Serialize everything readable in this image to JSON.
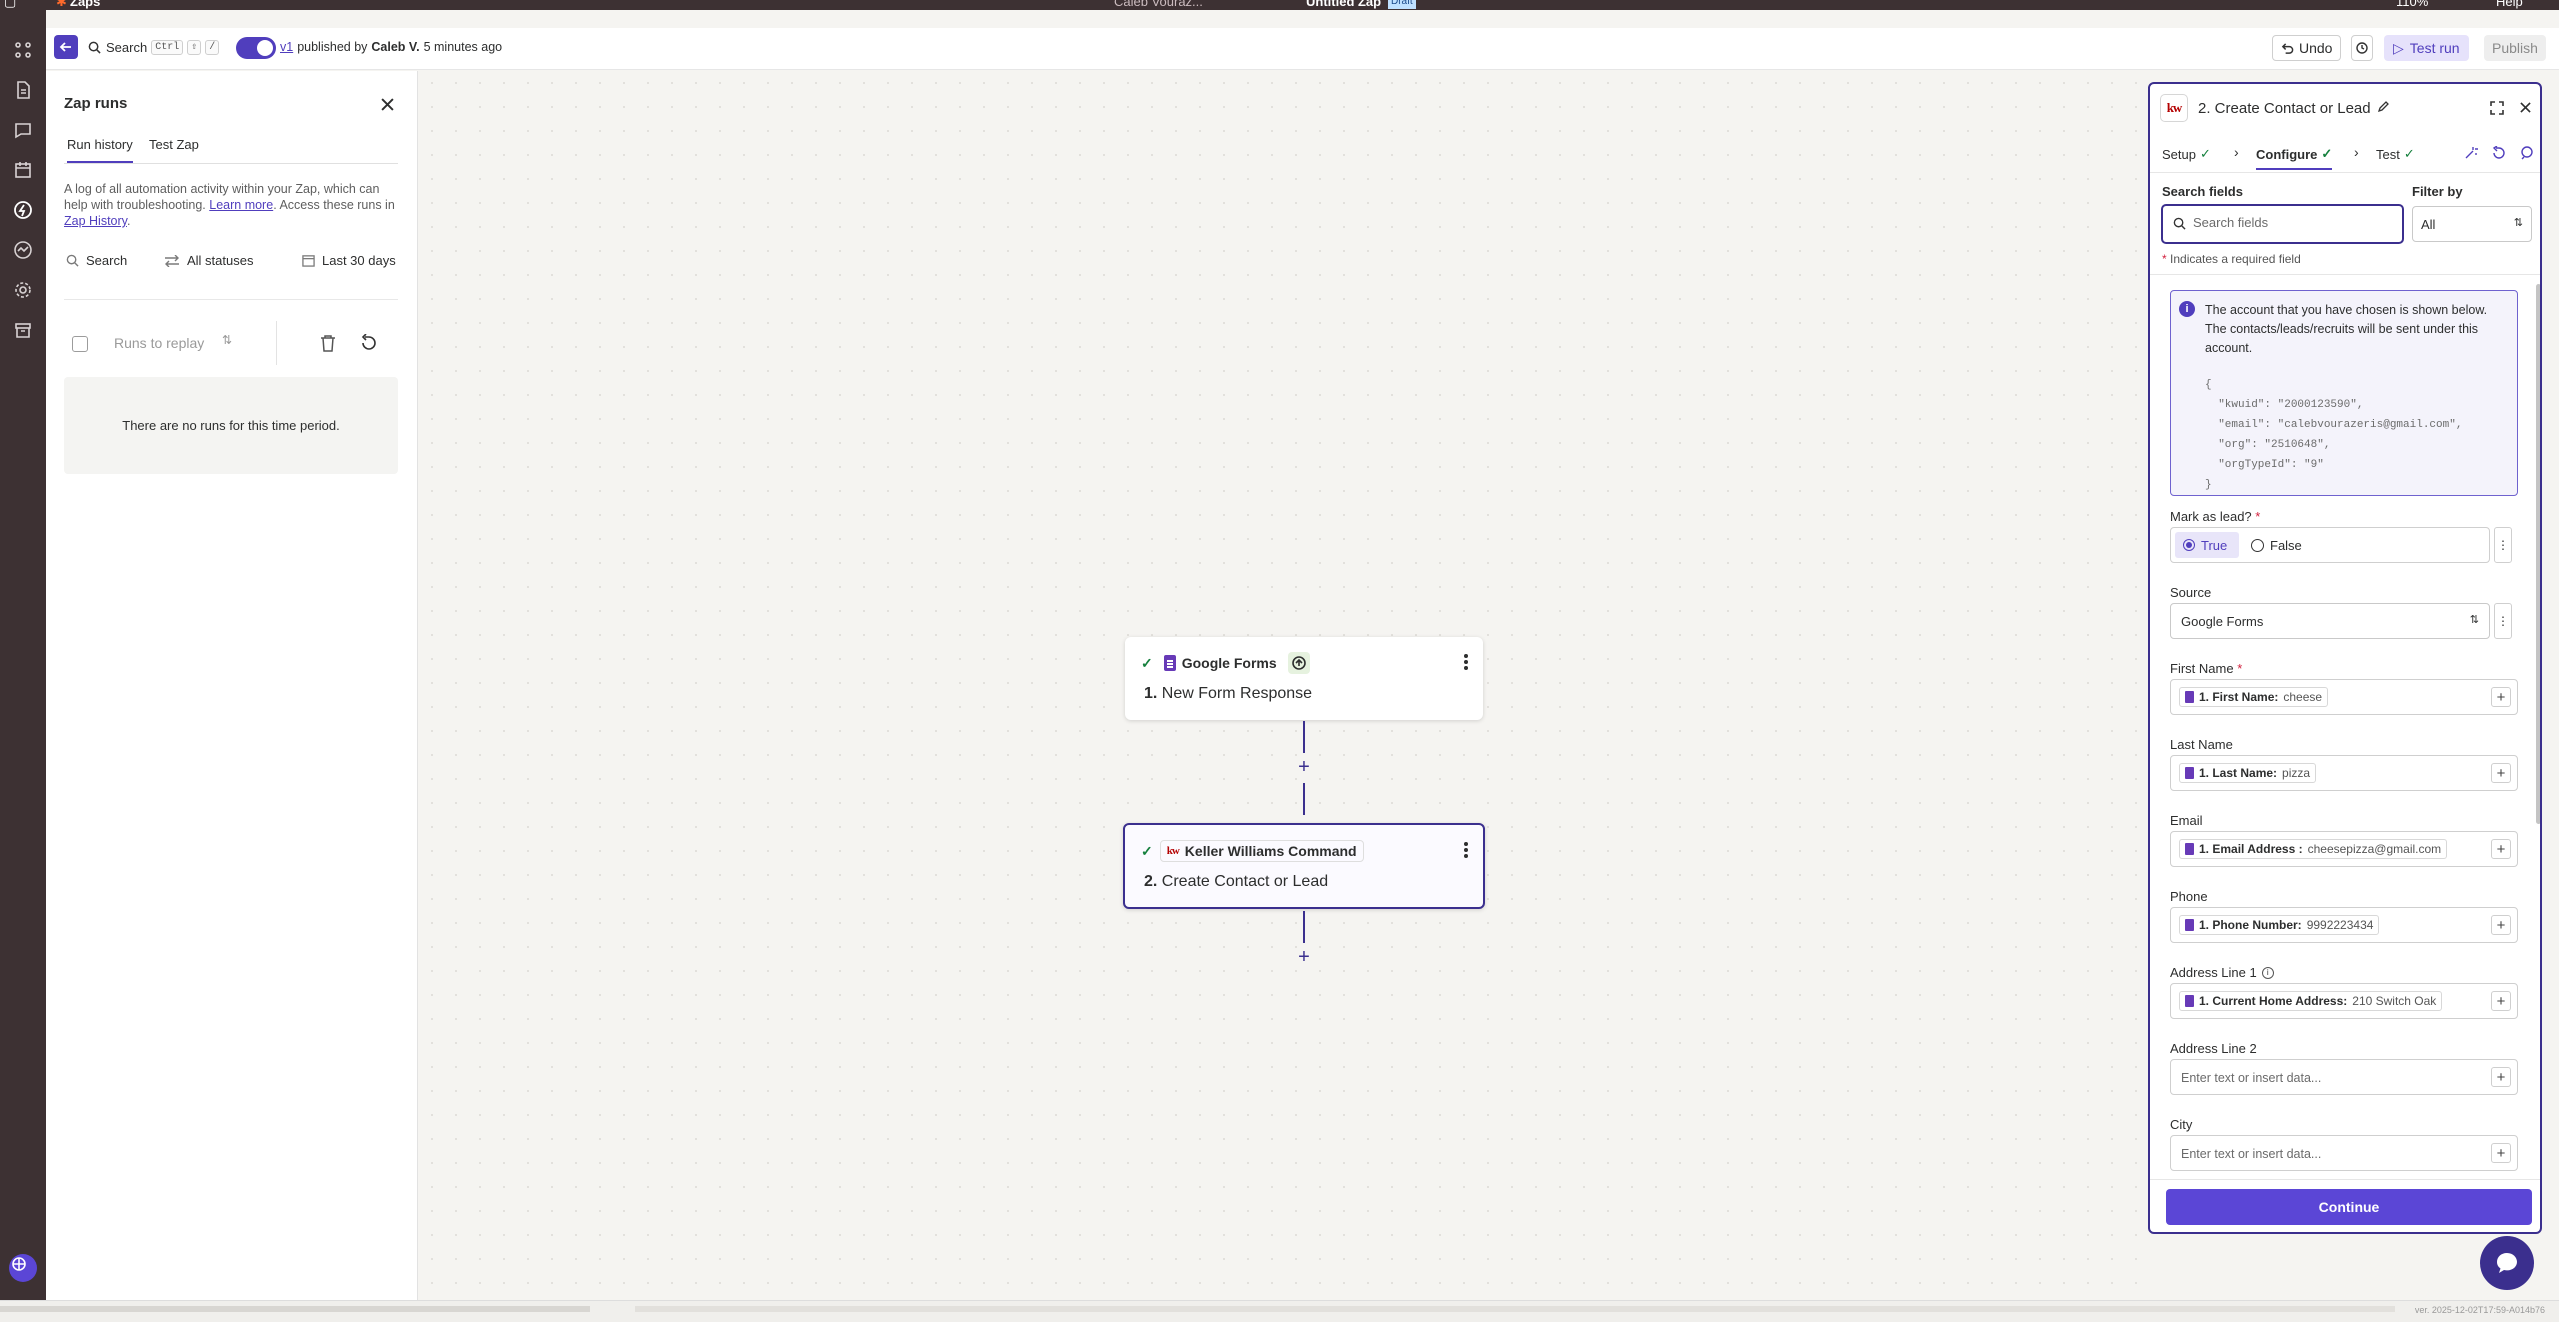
{
  "topbar": {
    "app_name": "Zaps",
    "user_name": "Caleb Vouraz...",
    "zap_title": "Untitled Zap",
    "status": "Draft",
    "zoom": "110%",
    "help": "Help"
  },
  "header": {
    "search_label": "Search",
    "shortcut_1": "Ctrl",
    "shortcut_2": "⇧",
    "shortcut_3": "/",
    "version": "v1",
    "published_by_prefix": "published by",
    "publisher": "Caleb V.",
    "published_time": "5 minutes ago",
    "undo_label": "Undo",
    "test_run_label": "Test run",
    "publish_label": "Publish"
  },
  "runs": {
    "title": "Zap runs",
    "tabs": [
      "Run history",
      "Test Zap"
    ],
    "description_1": "A log of all automation activity within your Zap, which can help with troubleshooting.",
    "learn_more": "Learn more",
    "description_2": ". Access these runs in",
    "zap_history": "Zap History",
    "description_end": ".",
    "filter_search": "Search",
    "filter_status": "All statuses",
    "filter_date": "Last 30 days",
    "replay_label": "Runs to replay",
    "empty_message": "There are no runs for this time period."
  },
  "canvas": {
    "nodes": [
      {
        "app": "Google Forms",
        "number": "1.",
        "step": "New Form Response"
      },
      {
        "app": "Keller Williams Command",
        "number": "2.",
        "step": "Create Contact or Lead"
      }
    ]
  },
  "panel": {
    "title": "2. Create Contact or Lead",
    "logo_text": "kw",
    "steps": [
      "Setup",
      "Configure",
      "Test"
    ],
    "search_label": "Search fields",
    "search_placeholder": "Search fields",
    "filter_label": "Filter by",
    "filter_value": "All",
    "required_note": "Indicates a required field",
    "info_message": "The account that you have chosen is shown below. The contacts/leads/recruits will be sent under this account.",
    "info_json_lines": [
      "{",
      "  \"kwuid\": \"2000123590\",",
      "  \"email\": \"calebvourazeris@gmail.com\",",
      "  \"org\": \"2510648\",",
      "  \"orgTypeId\": \"9\"",
      "}"
    ],
    "mark_as_lead_label": "Mark as lead?",
    "true_label": "True",
    "false_label": "False",
    "source_label": "Source",
    "source_value": "Google Forms",
    "fields": [
      {
        "label": "First Name",
        "required": true,
        "chip_key": "1. First Name:",
        "chip_value": "cheese"
      },
      {
        "label": "Last Name",
        "required": false,
        "chip_key": "1. Last Name:",
        "chip_value": "pizza"
      },
      {
        "label": "Email",
        "required": false,
        "chip_key": "1. Email Address :",
        "chip_value": "cheesepizza@gmail.com"
      },
      {
        "label": "Phone",
        "required": false,
        "chip_key": "1. Phone Number:",
        "chip_value": "9992223434"
      },
      {
        "label": "Address Line 1",
        "required": false,
        "chip_key": "1. Current Home Address:",
        "chip_value": "210 Switch Oak"
      },
      {
        "label": "Address Line 2",
        "required": false,
        "placeholder": "Enter text or insert data..."
      },
      {
        "label": "City",
        "required": false,
        "placeholder": "Enter text or insert data..."
      }
    ],
    "continue_label": "Continue"
  },
  "footer": {
    "version_text": "ver. 2025-12-02T17:59-A014b76"
  },
  "colors": {
    "accent": "#503ebd",
    "rail": "#3d3133",
    "success": "#15803d"
  }
}
